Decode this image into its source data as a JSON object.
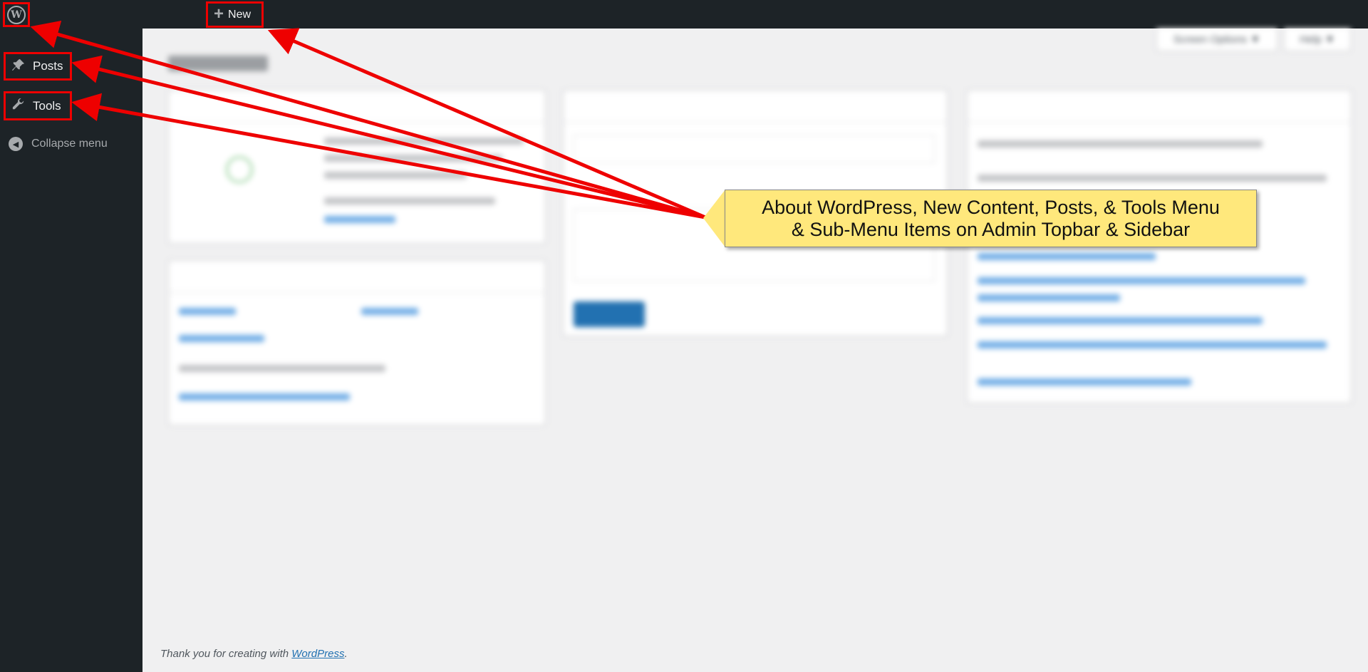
{
  "adminbar": {
    "logo_icon": "wordpress-logo-icon",
    "new_label": "New",
    "new_icon": "plus-icon"
  },
  "sidebar": {
    "items": [
      {
        "label": "Posts",
        "icon": "pushpin-icon"
      },
      {
        "label": "Tools",
        "icon": "wrench-icon"
      }
    ],
    "collapse_label": "Collapse menu",
    "collapse_icon": "collapse-arrow-icon"
  },
  "screen_meta": {
    "screen_options_label": "Screen Options ▼",
    "help_label": "Help ▼"
  },
  "footer": {
    "text": "Thank you for creating with ",
    "link": "WordPress",
    "period": "."
  },
  "annotation": {
    "line1": "About WordPress, New Content, Posts, & Tools Menu",
    "line2": "& Sub-Menu Items on Admin Topbar & Sidebar",
    "highlight_color": "#ee0000",
    "callout_color": "#ffe87c"
  }
}
